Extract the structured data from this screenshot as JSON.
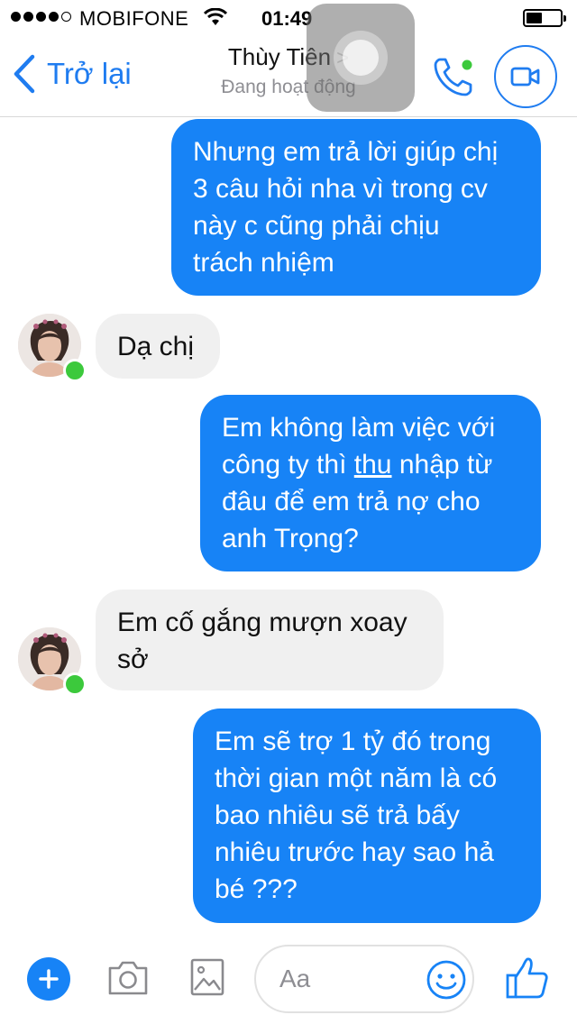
{
  "status_bar": {
    "carrier": "MOBIFONE",
    "time": "01:49"
  },
  "header": {
    "back_label": "Trở lại",
    "contact_name": "Thùy Tiên",
    "contact_chevron": ">",
    "status": "Đang hoạt động",
    "accent_color": "#1f7cf0"
  },
  "messages": [
    {
      "from": "me",
      "lines": [
        "Nhưng em trả lời giúp chị",
        "3 câu hỏi nha vì trong cv",
        "này c cũng phải chịu",
        "trách nhiệm"
      ]
    },
    {
      "from": "contact",
      "lines": [
        "Dạ chị"
      ]
    },
    {
      "from": "me",
      "lines": [
        "Em không làm việc với",
        "công ty thì",
        "thu",
        "nhập từ",
        "đâu để em trả nợ cho",
        "anh Trọng?"
      ]
    },
    {
      "from": "contact",
      "lines": [
        "Em cố gắng mượn xoay",
        "sở"
      ]
    },
    {
      "from": "me",
      "lines": [
        "Em sẽ trợ 1 tỷ đó trong",
        "thời gian một năm là có",
        "bao nhiêu sẽ trả bấy",
        "nhiêu trước hay sao hả",
        "bé ???"
      ]
    }
  ],
  "composer": {
    "placeholder": "Aa",
    "icons": [
      "plus-icon",
      "camera-icon",
      "image-icon",
      "emoji-icon",
      "thumbs-up-icon"
    ]
  },
  "colors": {
    "sent_bubble": "#1783f6",
    "received_bubble": "#f0f0f0",
    "online_dot": "#3cc93c"
  }
}
